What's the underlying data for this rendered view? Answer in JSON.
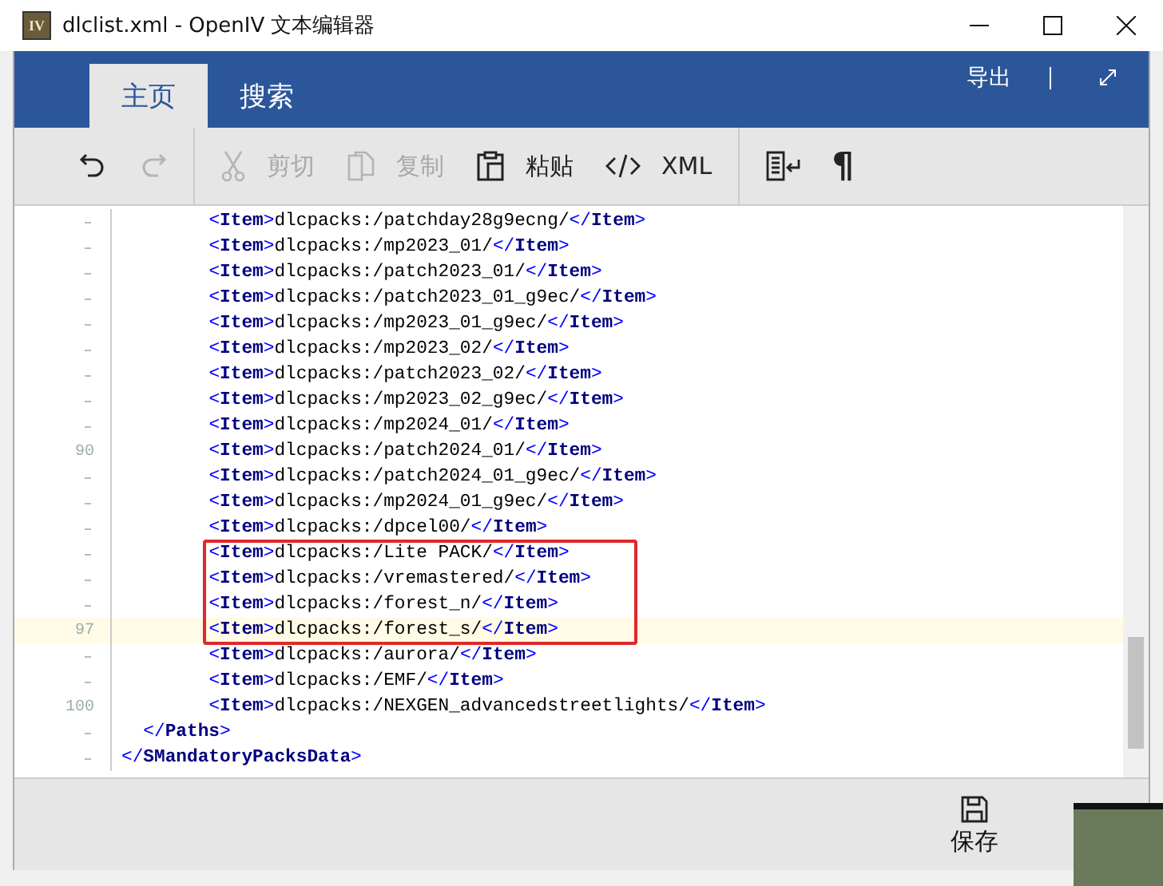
{
  "window": {
    "app_icon": "IV",
    "title": "dlclist.xml - OpenIV 文本编辑器"
  },
  "ribbon": {
    "tabs": [
      {
        "label": "主页",
        "selected": true
      },
      {
        "label": "搜索",
        "selected": false
      }
    ],
    "export": "导出"
  },
  "toolbar": {
    "groups": [
      [
        {
          "disabled": false
        },
        {
          "disabled": true
        }
      ],
      [
        {
          "label": "剪切",
          "disabled": true
        },
        {
          "label": "复制",
          "disabled": true
        },
        {
          "label": "粘贴",
          "disabled": false
        },
        {
          "label": "XML",
          "disabled": false
        }
      ],
      [
        {
          "disabled": false
        },
        {
          "glyph": "¶",
          "disabled": false
        }
      ]
    ]
  },
  "editor": {
    "lines": [
      {
        "text": "        <Item>dlcpacks:/patchday28g9ecng/</Item>",
        "current": false,
        "boxed": false
      },
      {
        "text": "        <Item>dlcpacks:/mp2023_01/</Item>",
        "current": false,
        "boxed": false
      },
      {
        "text": "        <Item>dlcpacks:/patch2023_01/</Item>",
        "current": false,
        "boxed": false
      },
      {
        "text": "        <Item>dlcpacks:/patch2023_01_g9ec/</Item>",
        "current": false,
        "boxed": false
      },
      {
        "text": "        <Item>dlcpacks:/mp2023_01_g9ec/</Item>",
        "current": false,
        "boxed": false
      },
      {
        "text": "        <Item>dlcpacks:/mp2023_02/</Item>",
        "current": false,
        "boxed": false
      },
      {
        "text": "        <Item>dlcpacks:/patch2023_02/</Item>",
        "current": false,
        "boxed": false
      },
      {
        "text": "        <Item>dlcpacks:/mp2023_02_g9ec/</Item>",
        "current": false,
        "boxed": false
      },
      {
        "text": "        <Item>dlcpacks:/mp2024_01/</Item>",
        "current": false,
        "boxed": false
      },
      {
        "number": "90",
        "text": "        <Item>dlcpacks:/patch2024_01/</Item>",
        "current": false,
        "boxed": false
      },
      {
        "text": "        <Item>dlcpacks:/patch2024_01_g9ec/</Item>",
        "current": false,
        "boxed": false
      },
      {
        "text": "        <Item>dlcpacks:/mp2024_01_g9ec/</Item>",
        "current": false,
        "boxed": false
      },
      {
        "text": "        <Item>dlcpacks:/dpcel00/</Item>",
        "current": false,
        "boxed": false
      },
      {
        "text": "        <Item>dlcpacks:/Lite PACK/</Item>",
        "current": false,
        "boxed": true
      },
      {
        "text": "        <Item>dlcpacks:/vremastered/</Item>",
        "current": false,
        "boxed": true
      },
      {
        "text": "        <Item>dlcpacks:/forest_n/</Item>",
        "current": false,
        "boxed": true
      },
      {
        "number": "97",
        "text": "        <Item>dlcpacks:/forest_s/</Item>",
        "current": true,
        "boxed": true
      },
      {
        "text": "        <Item>dlcpacks:/aurora/</Item>",
        "current": false,
        "boxed": false
      },
      {
        "text": "        <Item>dlcpacks:/EMF/</Item>",
        "current": false,
        "boxed": false
      },
      {
        "number": "100",
        "text": "        <Item>dlcpacks:/NEXGEN_advancedstreetlights/</Item>",
        "current": false,
        "boxed": false
      },
      {
        "text": "  </Paths>",
        "current": false,
        "boxed": false
      },
      {
        "text": "</SMandatoryPacksData>",
        "current": false,
        "boxed": false
      }
    ]
  },
  "bottom_bar": {
    "save": "保存"
  }
}
